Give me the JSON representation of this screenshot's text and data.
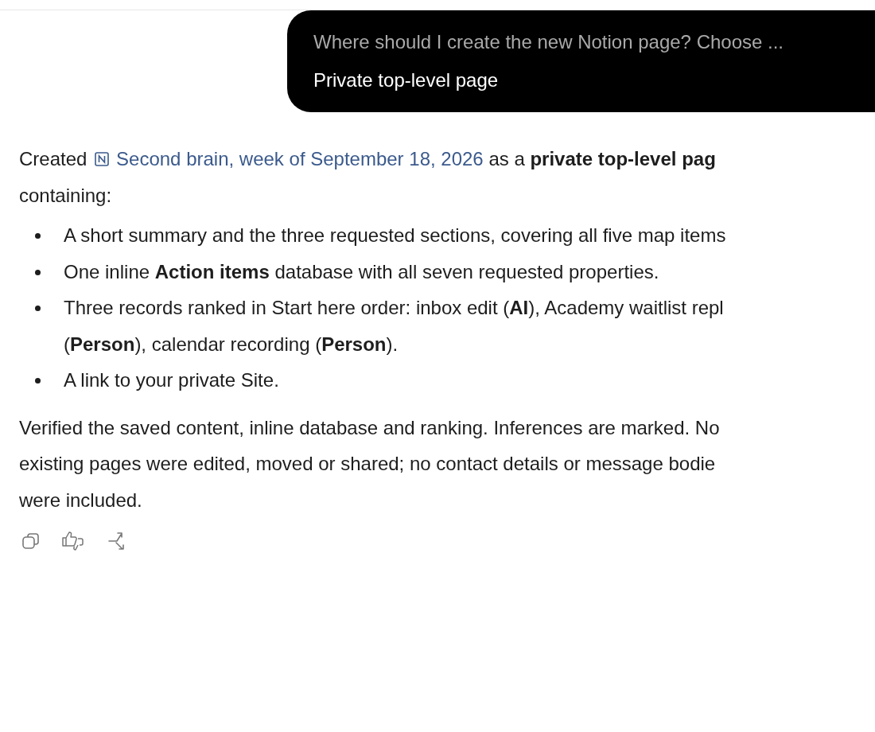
{
  "user_message": {
    "question": "Where should I create the new Notion page? Choose ...",
    "answer": "Private top-level page"
  },
  "response": {
    "intro_before": "Created",
    "page_link": "Second brain, week of September 18, 2026",
    "intro_after": "as a **private top-level pag**\ncontaining:",
    "bullets": [
      "A short summary and the three requested sections, covering all five map items",
      "One inline **Action items** database with all seven requested properties.",
      "Three records ranked in Start here order: inbox edit (**AI**), Academy waitlist repl\n(**Person**), calendar recording (**Person**).",
      "A link to your private Site."
    ],
    "closing": "Verified the saved content, inline database and ranking. Inferences are marked. No\nexisting pages were edited, moved or shared; no contact details or message bodie\nwere included."
  },
  "actions": [
    {
      "kind": "copy"
    },
    {
      "kind": "feedback"
    },
    {
      "kind": "share"
    }
  ]
}
